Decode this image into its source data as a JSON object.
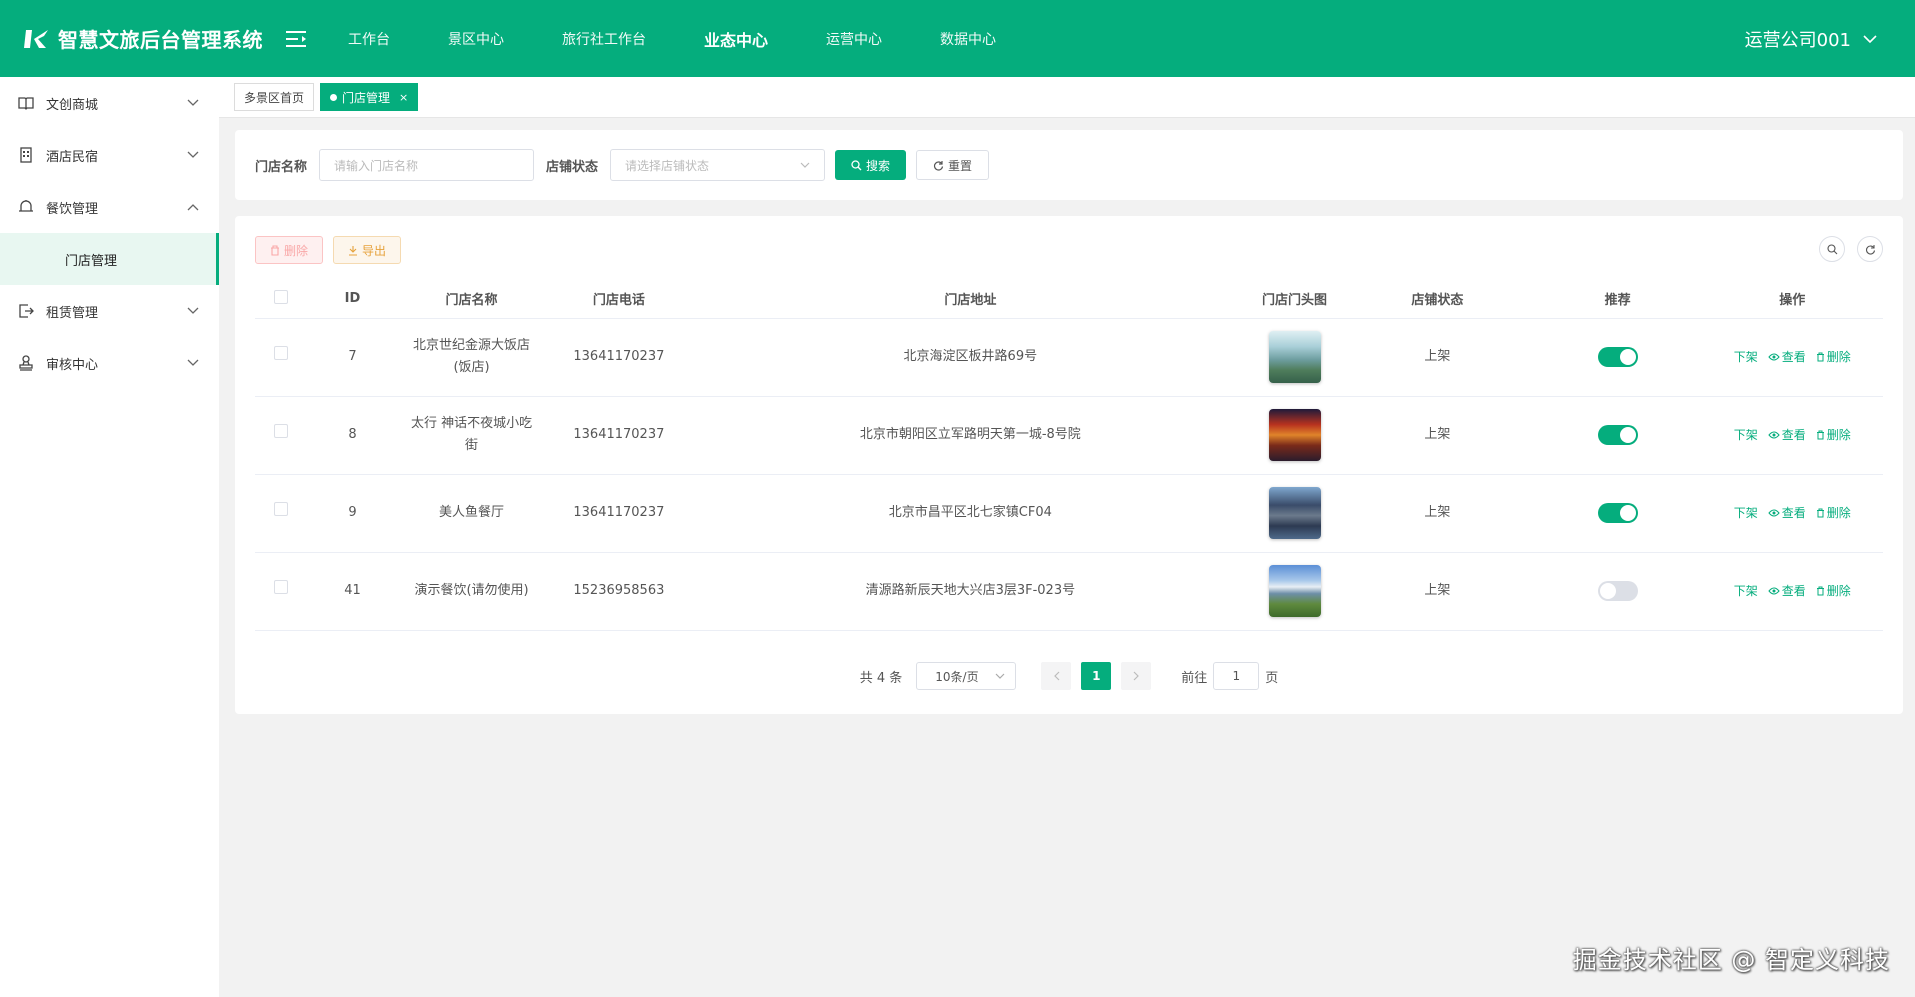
{
  "header": {
    "app_title": "智慧文旅后台管理系统",
    "nav": [
      "工作台",
      "景区中心",
      "旅行社工作台",
      "业态中心",
      "运营中心",
      "数据中心"
    ],
    "active_nav": "业态中心",
    "user_name": "运营公司001"
  },
  "sidebar": {
    "items": [
      {
        "label": "文创商城",
        "icon": "book-icon",
        "expanded": false
      },
      {
        "label": "酒店民宿",
        "icon": "building-icon",
        "expanded": false
      },
      {
        "label": "餐饮管理",
        "icon": "bell-icon",
        "expanded": true
      },
      {
        "label": "租赁管理",
        "icon": "exit-icon",
        "expanded": false
      },
      {
        "label": "审核中心",
        "icon": "stamp-icon",
        "expanded": false
      }
    ],
    "sub_item": "门店管理"
  },
  "tabs": {
    "home": "多景区首页",
    "current": "门店管理",
    "close": "×"
  },
  "search": {
    "name_label": "门店名称",
    "name_placeholder": "请输入门店名称",
    "status_label": "店铺状态",
    "status_placeholder": "请选择店铺状态",
    "search_btn": "搜索",
    "reset_btn": "重置"
  },
  "toolbar": {
    "delete_btn": "删除",
    "export_btn": "导出"
  },
  "table": {
    "columns": [
      "ID",
      "门店名称",
      "门店电话",
      "门店地址",
      "门店门头图",
      "店铺状态",
      "推荐",
      "操作"
    ],
    "rows": [
      {
        "id": "7",
        "name_line1": "北京世纪金源大饭店",
        "name_line2": "(饭店)",
        "phone": "13641170237",
        "address": "北京海淀区板井路69号",
        "status": "上架",
        "recommend": true
      },
      {
        "id": "8",
        "name_line1": "太行 神话不夜城小吃",
        "name_line2": "街",
        "phone": "13641170237",
        "address": "北京市朝阳区立军路明天第一城-8号院",
        "status": "上架",
        "recommend": true
      },
      {
        "id": "9",
        "name_line1": "美人鱼餐厅",
        "name_line2": "",
        "phone": "13641170237",
        "address": "北京市昌平区北七家镇CF04",
        "status": "上架",
        "recommend": true
      },
      {
        "id": "41",
        "name_line1": "演示餐饮(请勿使用)",
        "name_line2": "",
        "phone": "15236958563",
        "address": "清源路新辰天地大兴店3层3F-023号",
        "status": "上架",
        "recommend": false
      }
    ],
    "actions": {
      "off": "下架",
      "view": "查看",
      "delete": "删除"
    }
  },
  "pagination": {
    "total": "共 4 条",
    "page_size": "10条/页",
    "current_page": "1",
    "goto_label": "前往",
    "goto_value": "1",
    "page_unit": "页"
  },
  "watermark": "掘金技术社区 @ 智定义科技",
  "colors": {
    "primary": "#05ad7d",
    "danger_light": "#fef0f0",
    "warning_light": "#fdf6ec"
  }
}
